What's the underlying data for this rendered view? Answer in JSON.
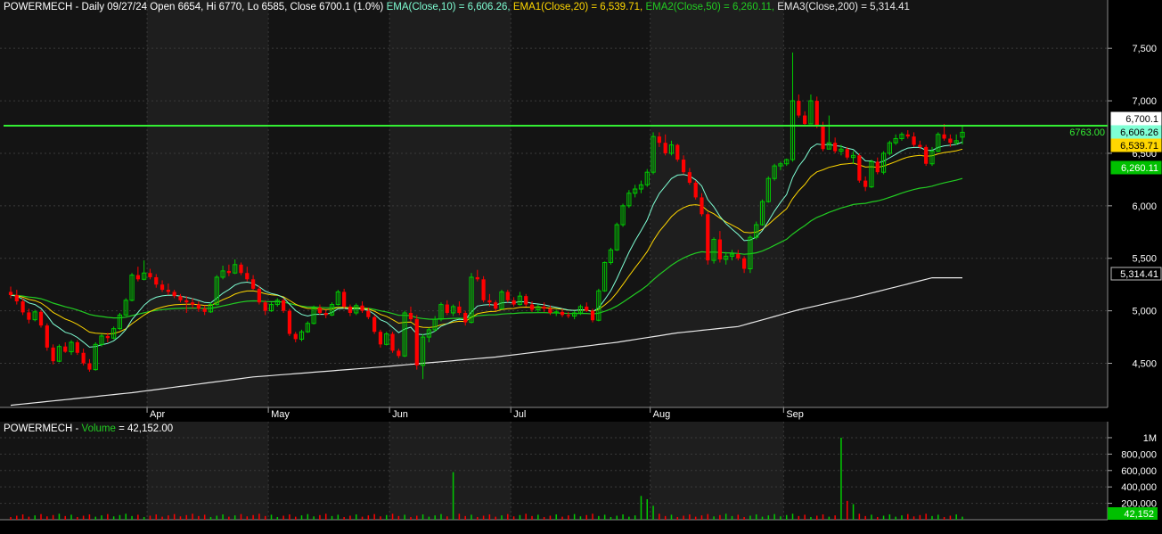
{
  "colors": {
    "background": "#000000",
    "pane": "#1e1e1e",
    "pane_alt": "#141414",
    "grid": "#3a3a3a",
    "up": "#00cc00",
    "down": "#ff0000",
    "ema10": "#7fffd4",
    "ema20": "#ffd700",
    "ema50": "#22cc22",
    "ema200": "#e8e8e8",
    "hline": "#33ee33",
    "text": "#ffffff"
  },
  "header": {
    "symbol_info": "POWERMECH - Daily 09/27/24 Open 6654, Hi 6770, Lo 6585, Close 6700.1 (1.0%)",
    "ema10_label": "EMA(Close,10) = 6,606.26,",
    "ema20_label": "EMA1(Close,20) = 6,539.71,",
    "ema50_label": "EMA2(Close,50) = 6,260.11,",
    "ema200_label": "EMA3(Close,200) = 5,314.41"
  },
  "volume_header": {
    "symbol": "POWERMECH -",
    "label": "Volume",
    "value": "= 42,152.00"
  },
  "chart_data": {
    "type": "candlestick",
    "price_axis": {
      "ticks": [
        4500,
        5000,
        5500,
        6000,
        6500,
        7000,
        7500
      ],
      "tick_labels": [
        "4,500",
        "5,000",
        "5,500",
        "6,000",
        "6,500",
        "7,000",
        "7,500"
      ],
      "range": [
        4080,
        7960
      ]
    },
    "x_axis": {
      "labels": [
        "Apr",
        "May",
        "Jun",
        "Jul",
        "Aug",
        "Sep"
      ],
      "label_bar_index": [
        23,
        43,
        63,
        83,
        106,
        128
      ]
    },
    "horizontal_line": {
      "value": 6763.0,
      "label": "6763.00"
    },
    "last_value_badges": [
      {
        "value": 6700.1,
        "label": "6,700.1",
        "series": "close"
      },
      {
        "value": 6606.26,
        "label": "6,606.26",
        "series": "ema10"
      },
      {
        "value": 6539.71,
        "label": "6,539.71",
        "series": "ema20"
      },
      {
        "value": 6260.11,
        "label": "6,260.11",
        "series": "ema50"
      },
      {
        "value": 5314.41,
        "label": "5,314.41",
        "series": "ema200"
      }
    ],
    "ohlc": [
      [
        5180,
        5230,
        5120,
        5150
      ],
      [
        5150,
        5200,
        5060,
        5090
      ],
      [
        5090,
        5120,
        4960,
        4985
      ],
      [
        4985,
        5020,
        4880,
        4915
      ],
      [
        4915,
        5010,
        4900,
        4990
      ],
      [
        4990,
        5010,
        4840,
        4860
      ],
      [
        4860,
        4880,
        4620,
        4650
      ],
      [
        4650,
        4680,
        4490,
        4520
      ],
      [
        4520,
        4680,
        4510,
        4660
      ],
      [
        4660,
        4700,
        4600,
        4610
      ],
      [
        4610,
        4720,
        4580,
        4700
      ],
      [
        4700,
        4720,
        4580,
        4600
      ],
      [
        4600,
        4640,
        4480,
        4500
      ],
      [
        4500,
        4540,
        4420,
        4440
      ],
      [
        4440,
        4700,
        4430,
        4680
      ],
      [
        4680,
        4780,
        4660,
        4760
      ],
      [
        4760,
        4790,
        4700,
        4740
      ],
      [
        4740,
        4850,
        4730,
        4830
      ],
      [
        4830,
        4980,
        4820,
        4960
      ],
      [
        4960,
        5120,
        4950,
        5100
      ],
      [
        5100,
        5360,
        5090,
        5340
      ],
      [
        5340,
        5420,
        5280,
        5300
      ],
      [
        5300,
        5480,
        5290,
        5360
      ],
      [
        5360,
        5400,
        5300,
        5320
      ],
      [
        5320,
        5350,
        5220,
        5250
      ],
      [
        5250,
        5290,
        5180,
        5200
      ],
      [
        5200,
        5260,
        5150,
        5180
      ],
      [
        5180,
        5200,
        5120,
        5140
      ],
      [
        5140,
        5160,
        5080,
        5100
      ],
      [
        5100,
        5140,
        4980,
        5080
      ],
      [
        5080,
        5120,
        5020,
        5060
      ],
      [
        5060,
        5090,
        4990,
        5020
      ],
      [
        5020,
        5050,
        4960,
        4990
      ],
      [
        4990,
        5080,
        4980,
        5060
      ],
      [
        5060,
        5340,
        5050,
        5320
      ],
      [
        5320,
        5430,
        5300,
        5380
      ],
      [
        5380,
        5440,
        5330,
        5360
      ],
      [
        5360,
        5490,
        5350,
        5440
      ],
      [
        5440,
        5460,
        5340,
        5360
      ],
      [
        5360,
        5420,
        5280,
        5300
      ],
      [
        5300,
        5340,
        5200,
        5210
      ],
      [
        5210,
        5240,
        5060,
        5080
      ],
      [
        5080,
        5100,
        4960,
        5000
      ],
      [
        5000,
        5080,
        4990,
        5060
      ],
      [
        5060,
        5120,
        5040,
        5100
      ],
      [
        5100,
        5120,
        4980,
        5000
      ],
      [
        5000,
        5020,
        4760,
        4780
      ],
      [
        4780,
        4800,
        4700,
        4730
      ],
      [
        4730,
        4820,
        4710,
        4800
      ],
      [
        4800,
        4900,
        4790,
        4880
      ],
      [
        4880,
        5050,
        4870,
        5030
      ],
      [
        5030,
        5060,
        4960,
        4980
      ],
      [
        4980,
        5010,
        4930,
        4960
      ],
      [
        4960,
        5080,
        4950,
        5060
      ],
      [
        5060,
        5200,
        5050,
        5180
      ],
      [
        5180,
        5210,
        5020,
        5040
      ],
      [
        5040,
        5060,
        4950,
        4980
      ],
      [
        4980,
        5070,
        4960,
        5050
      ],
      [
        5050,
        5090,
        4980,
        5000
      ],
      [
        5000,
        5030,
        4920,
        4940
      ],
      [
        4940,
        4960,
        4780,
        4800
      ],
      [
        4800,
        4820,
        4650,
        4680
      ],
      [
        4680,
        4800,
        4670,
        4780
      ],
      [
        4780,
        4800,
        4600,
        4620
      ],
      [
        4620,
        4640,
        4550,
        4570
      ],
      [
        4570,
        5000,
        4560,
        4980
      ],
      [
        4980,
        5040,
        4900,
        4920
      ],
      [
        4920,
        4960,
        4440,
        4480
      ],
      [
        4480,
        4780,
        4350,
        4750
      ],
      [
        4750,
        4840,
        4700,
        4820
      ],
      [
        4820,
        4950,
        4800,
        4920
      ],
      [
        4920,
        5080,
        4900,
        5060
      ],
      [
        5060,
        5100,
        4960,
        4980
      ],
      [
        4980,
        5060,
        4950,
        5040
      ],
      [
        5040,
        5090,
        4960,
        4980
      ],
      [
        4980,
        5000,
        4860,
        4890
      ],
      [
        4890,
        5360,
        4880,
        5320
      ],
      [
        5320,
        5390,
        5280,
        5300
      ],
      [
        5300,
        5330,
        5080,
        5100
      ],
      [
        5100,
        5160,
        5040,
        5080
      ],
      [
        5080,
        5100,
        5000,
        5020
      ],
      [
        5020,
        5200,
        5010,
        5180
      ],
      [
        5180,
        5200,
        5080,
        5100
      ],
      [
        5100,
        5130,
        5040,
        5060
      ],
      [
        5060,
        5180,
        5050,
        5140
      ],
      [
        5140,
        5160,
        5040,
        5060
      ],
      [
        5060,
        5090,
        4990,
        5010
      ],
      [
        5010,
        5060,
        4980,
        5040
      ],
      [
        5040,
        5080,
        4990,
        5020
      ],
      [
        5020,
        5050,
        4960,
        4980
      ],
      [
        4980,
        5010,
        4950,
        4990
      ],
      [
        4990,
        5020,
        4940,
        4960
      ],
      [
        4960,
        4990,
        4930,
        4950
      ],
      [
        4950,
        5000,
        4920,
        4980
      ],
      [
        4980,
        5060,
        4960,
        5040
      ],
      [
        5040,
        5080,
        4990,
        5000
      ],
      [
        5000,
        5020,
        4890,
        4910
      ],
      [
        4910,
        5210,
        4900,
        5190
      ],
      [
        5190,
        5470,
        5180,
        5460
      ],
      [
        5460,
        5600,
        5440,
        5580
      ],
      [
        5580,
        5840,
        5570,
        5820
      ],
      [
        5820,
        6020,
        5800,
        6000
      ],
      [
        6000,
        6150,
        5980,
        6120
      ],
      [
        6120,
        6200,
        6080,
        6160
      ],
      [
        6160,
        6240,
        6120,
        6200
      ],
      [
        6200,
        6350,
        6180,
        6320
      ],
      [
        6320,
        6700,
        6300,
        6660
      ],
      [
        6660,
        6700,
        6560,
        6600
      ],
      [
        6600,
        6680,
        6480,
        6500
      ],
      [
        6500,
        6620,
        6480,
        6580
      ],
      [
        6580,
        6590,
        6420,
        6440
      ],
      [
        6440,
        6480,
        6300,
        6320
      ],
      [
        6320,
        6360,
        6200,
        6220
      ],
      [
        6220,
        6240,
        6060,
        6080
      ],
      [
        6080,
        6120,
        5900,
        5920
      ],
      [
        5920,
        5940,
        5440,
        5480
      ],
      [
        5480,
        5700,
        5450,
        5680
      ],
      [
        5680,
        5760,
        5460,
        5490
      ],
      [
        5490,
        5560,
        5440,
        5520
      ],
      [
        5520,
        5580,
        5480,
        5540
      ],
      [
        5540,
        5580,
        5480,
        5500
      ],
      [
        5500,
        5520,
        5360,
        5400
      ],
      [
        5400,
        5720,
        5360,
        5700
      ],
      [
        5700,
        5850,
        5680,
        5820
      ],
      [
        5820,
        6060,
        5810,
        6040
      ],
      [
        6040,
        6280,
        6030,
        6260
      ],
      [
        6260,
        6400,
        6240,
        6380
      ],
      [
        6380,
        6420,
        6340,
        6400
      ],
      [
        6400,
        6450,
        6380,
        6440
      ],
      [
        6440,
        7460,
        6420,
        7000
      ],
      [
        7000,
        7060,
        6840,
        6860
      ],
      [
        6860,
        6900,
        6760,
        6780
      ],
      [
        6780,
        7060,
        6780,
        7000
      ],
      [
        7000,
        7040,
        6740,
        6760
      ],
      [
        6760,
        6800,
        6520,
        6540
      ],
      [
        6540,
        6860,
        6540,
        6600
      ],
      [
        6600,
        6650,
        6500,
        6520
      ],
      [
        6520,
        6580,
        6480,
        6540
      ],
      [
        6540,
        6560,
        6440,
        6460
      ],
      [
        6460,
        6520,
        6400,
        6480
      ],
      [
        6480,
        6500,
        6220,
        6240
      ],
      [
        6240,
        6280,
        6140,
        6180
      ],
      [
        6180,
        6440,
        6170,
        6420
      ],
      [
        6420,
        6460,
        6300,
        6320
      ],
      [
        6320,
        6520,
        6300,
        6500
      ],
      [
        6500,
        6620,
        6480,
        6600
      ],
      [
        6600,
        6680,
        6580,
        6640
      ],
      [
        6640,
        6700,
        6620,
        6680
      ],
      [
        6680,
        6720,
        6640,
        6660
      ],
      [
        6660,
        6700,
        6560,
        6580
      ],
      [
        6580,
        6620,
        6540,
        6560
      ],
      [
        6560,
        6580,
        6380,
        6400
      ],
      [
        6400,
        6560,
        6380,
        6520
      ],
      [
        6520,
        6700,
        6510,
        6680
      ],
      [
        6680,
        6780,
        6620,
        6640
      ],
      [
        6640,
        6680,
        6560,
        6600
      ],
      [
        6600,
        6680,
        6580,
        6620
      ],
      [
        6654,
        6770,
        6585,
        6700.1
      ]
    ],
    "volume": {
      "axis_ticks": [
        200000,
        400000,
        600000,
        800000,
        1000000
      ],
      "axis_labels": [
        "200,000",
        "400,000",
        "600,000",
        "800,000",
        "1M"
      ],
      "range": [
        0,
        1130000
      ],
      "last_label": "42,152",
      "spikes": {
        "73": 580000,
        "104": 290000,
        "105": 250000,
        "106": 170000,
        "137": 1000000,
        "138": 230000,
        "139": 190000
      },
      "baseline": 55000
    },
    "ema_lines": [
      {
        "name": "EMA(Close,10)",
        "period": 10,
        "color": "#7fffd4",
        "last": 6606.26
      },
      {
        "name": "EMA1(Close,20)",
        "period": 20,
        "color": "#ffd700",
        "last": 6539.71
      },
      {
        "name": "EMA2(Close,50)",
        "period": 50,
        "color": "#22cc22",
        "last": 6260.11
      },
      {
        "name": "EMA3(Close,200)",
        "period": 200,
        "color": "#e8e8e8",
        "last": 5314.41
      }
    ],
    "ema200_path": [
      [
        0,
        4100
      ],
      [
        20,
        4220
      ],
      [
        40,
        4370
      ],
      [
        60,
        4460
      ],
      [
        80,
        4560
      ],
      [
        100,
        4700
      ],
      [
        110,
        4790
      ],
      [
        120,
        4850
      ],
      [
        130,
        5010
      ],
      [
        140,
        5140
      ],
      [
        152,
        5314.41
      ]
    ]
  }
}
